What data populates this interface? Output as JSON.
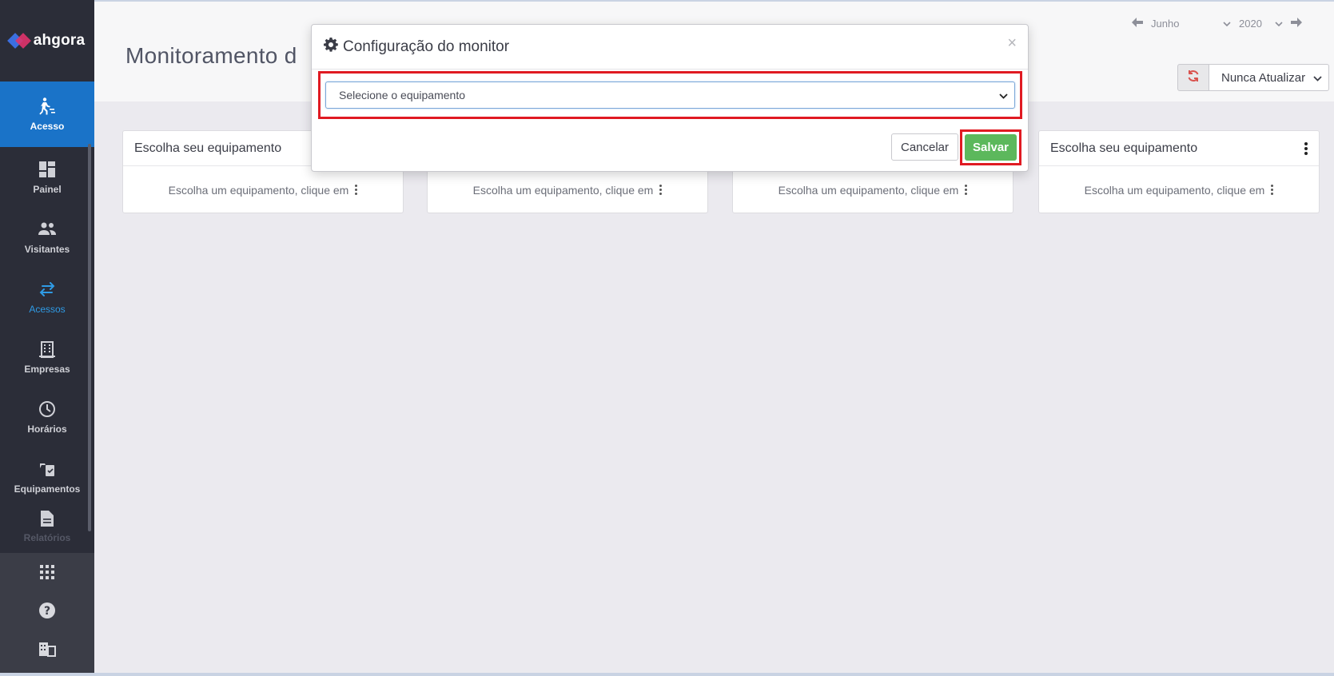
{
  "sidebar": {
    "logo": "ahgora",
    "items": [
      {
        "label": "Acesso",
        "icon": "person-walking-icon"
      },
      {
        "label": "Painel",
        "icon": "dashboard-icon"
      },
      {
        "label": "Visitantes",
        "icon": "users-icon"
      },
      {
        "label": "Acessos",
        "icon": "arrows-swap-icon"
      },
      {
        "label": "Empresas",
        "icon": "building-icon"
      },
      {
        "label": "Horários",
        "icon": "clock-icon"
      },
      {
        "label": "Equipamentos",
        "icon": "device-icon"
      },
      {
        "label": "Relatórios",
        "icon": "document-icon"
      }
    ],
    "bottom_icons": [
      "apps-grid-icon",
      "help-icon",
      "company-icon"
    ]
  },
  "header": {
    "title": "Monitoramento d",
    "month": "Junho",
    "year": "2020",
    "refresh_select": "Nunca Atualizar"
  },
  "cards": [
    {
      "title": "Escolha seu equipamento",
      "body": "Escolha um equipamento, clique em"
    },
    {
      "title": "",
      "body": "Escolha um equipamento, clique em"
    },
    {
      "title": "",
      "body": "Escolha um equipamento, clique em"
    },
    {
      "title": "Escolha seu equipamento",
      "body": "Escolha um equipamento, clique em"
    }
  ],
  "modal": {
    "title": "Configuração do monitor",
    "close": "×",
    "select_placeholder": "Selecione o equipamento",
    "cancel_label": "Cancelar",
    "save_label": "Salvar"
  },
  "colors": {
    "sidebar": "#2b2d38",
    "active": "#1a73c8",
    "save": "#5cb85c",
    "highlight": "#e01a22"
  }
}
